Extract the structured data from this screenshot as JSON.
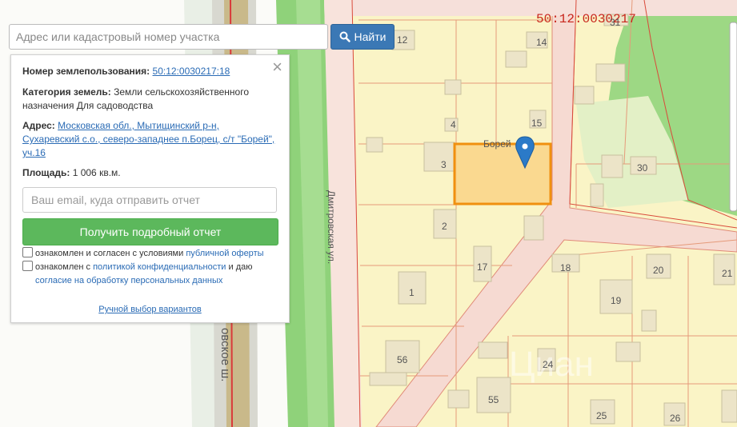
{
  "search": {
    "placeholder": "Адрес или кадастровый номер участка",
    "button_label": "Найти"
  },
  "map": {
    "quarter_label": "50:12:0030217",
    "street_label": "Дмитровская ул.",
    "highway_label": "овское ш.",
    "selected_area_label": "Борей",
    "watermark": "Циан",
    "plot_numbers": [
      "12",
      "14",
      "31",
      "4",
      "15",
      "3",
      "30",
      "2",
      "17",
      "18",
      "20",
      "21",
      "1",
      "19",
      "56",
      "24",
      "55",
      "25",
      "26"
    ]
  },
  "info_panel": {
    "usage_number_label": "Номер землепользования:",
    "usage_number_value": "50:12:0030217:18",
    "category_label": "Категория земель:",
    "category_value": "Земли сельскохозяйственного назначения Для садоводства",
    "address_label": "Адрес:",
    "address_value": "Московская обл., Мытищинский р-н, Сухаревский с.о., северо-западнее п.Борец, с/т \"Борей\", уч.16",
    "area_label": "Площадь:",
    "area_value": "1 006 кв.м.",
    "email_placeholder": "Ваш email, куда отправить отчет",
    "report_button": "Получить подробный отчет",
    "offer_prefix": "ознакомлен и согласен с условиями",
    "offer_link": "публичной оферты",
    "privacy_prefix": "ознакомлен с",
    "privacy_link": "политикой конфиденциальности",
    "privacy_mid": "и даю",
    "consent_link": "согласие на обработку персональных данных",
    "manual_link": "Ручной выбор вариантов"
  },
  "colors": {
    "parcel_fill": "#faf3c0",
    "parcel_border": "#e06a4a",
    "road": "#f5dcd5",
    "green": "#8fcf70",
    "selected_fill": "#f9d88f",
    "selected_border": "#f0900f",
    "marker": "#2b7ac8",
    "button_blue": "#3b78b5",
    "button_green": "#5cb85c"
  }
}
